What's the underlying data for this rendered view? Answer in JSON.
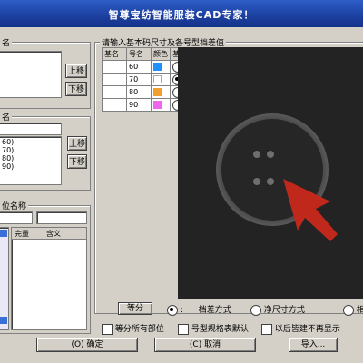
{
  "window": {
    "title": "智尊宝纺智能服装CAD专家！"
  },
  "left_panel": {
    "group1": {
      "title": "名",
      "up": "上移",
      "down": "下移"
    },
    "group2": {
      "title": "名",
      "items": [
        "60)",
        "70)",
        "80)",
        "90)"
      ],
      "up": "上移",
      "down": "下移"
    },
    "group3": {
      "title": "位名称",
      "columns": [
        "完量",
        "含义"
      ]
    }
  },
  "right_panel": {
    "group_title": "请输入基本码尺寸及各号型档差值",
    "table": {
      "headers": [
        "基名",
        "号名",
        "颜色",
        "基"
      ],
      "rows": [
        {
          "size": "60",
          "color": "#1e90ff",
          "base": false
        },
        {
          "size": "70",
          "color": "#ffffff",
          "base": true
        },
        {
          "size": "80",
          "color": "#f0a030",
          "base": false
        },
        {
          "size": "90",
          "color": "#ee66ee",
          "base": false
        }
      ]
    },
    "grade_button": "等分",
    "radio_1": ":",
    "radio_1_text": "档差方式",
    "radio_2": "净尺寸方式",
    "radio_3": "相"
  },
  "options": {
    "check1": "等分所有部位",
    "check2": "号型规格表默认",
    "check3": "以后皆建不再显示"
  },
  "footer": {
    "ok": "(O) 确定",
    "cancel": "(C) 取消",
    "import": "导入..."
  },
  "colors": {
    "titlebar": "#1c3f9e",
    "accent_arrow": "#c0281c",
    "canvas": "#232323"
  }
}
